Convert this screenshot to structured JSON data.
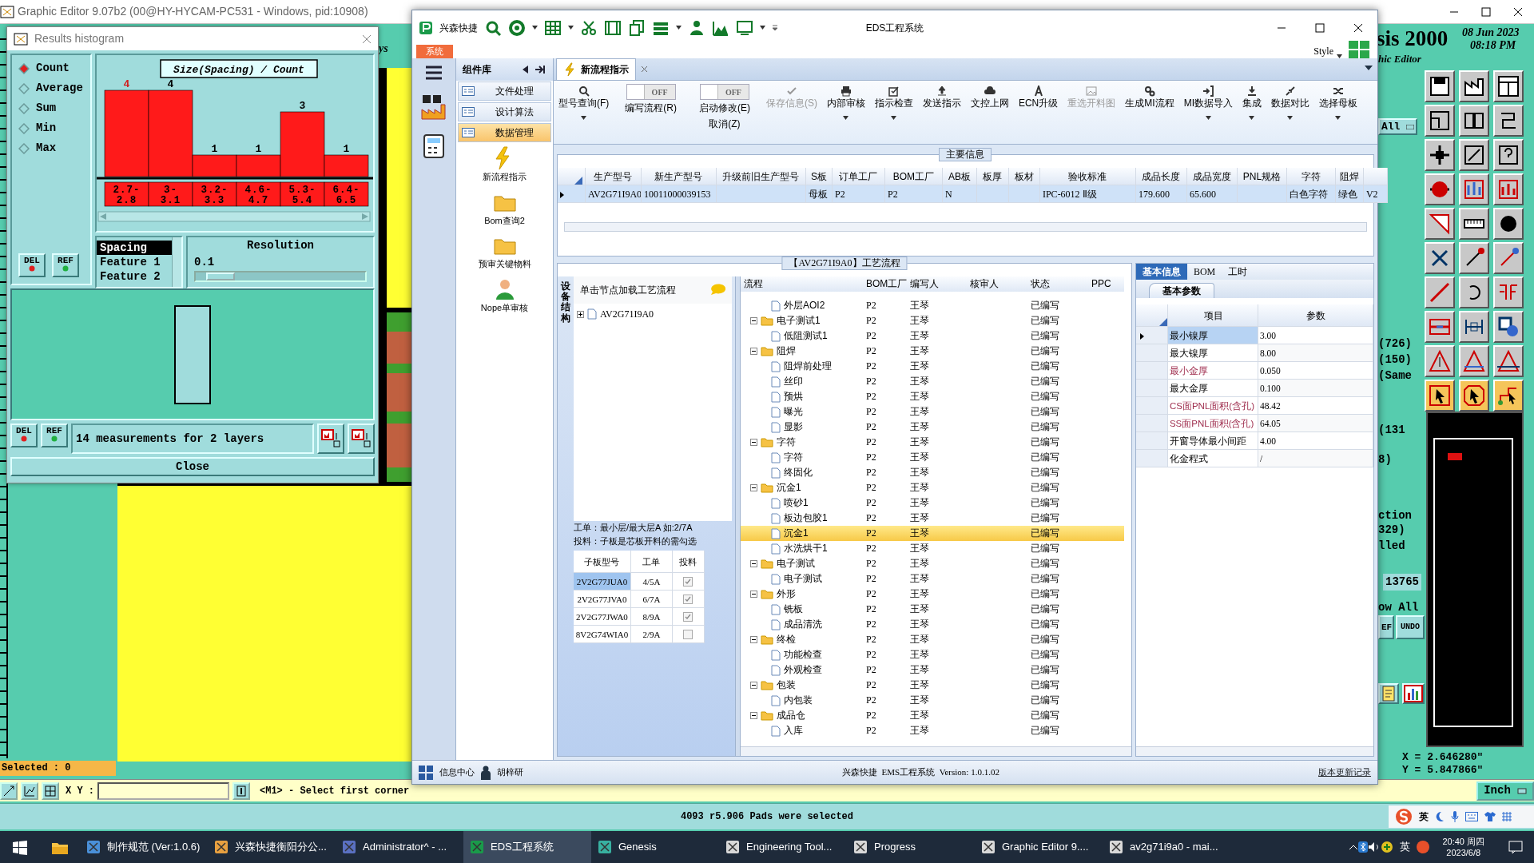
{
  "genesis": {
    "title": "Graphic Editor 9.07b2 (00@HY-HYCAM-PC531 - Windows, pid:10908)",
    "menu_fragment": "ys",
    "product": "sis 2000",
    "date": "08 Jun 2023",
    "time": "08:18 PM",
    "subtitle": "hic Editor",
    "filter": "All",
    "info_lines": [
      "(726)",
      "(150)",
      "(Same",
      "(131",
      "8)",
      "ction",
      "329)",
      "lled"
    ],
    "count": "13765",
    "show_all": "ow All",
    "ref_button": "EF",
    "undo_button": "UNDO",
    "coord_x": "X = 2.646280\"",
    "coord_y": "Y = 5.847866\"",
    "units": "Inch",
    "selected": "Selected : 0",
    "xy_label": "X Y :",
    "prompt": "<M1> - Select first corner",
    "status": "4093 r5.906 Pads were selected"
  },
  "histogram": {
    "title": "Results histogram",
    "modes": [
      {
        "label": "Count",
        "selected": true
      },
      {
        "label": "Average",
        "selected": false
      },
      {
        "label": "Sum",
        "selected": false
      },
      {
        "label": "Min",
        "selected": false
      },
      {
        "label": "Max",
        "selected": false
      }
    ],
    "top_buttons": [
      "DEL",
      "REF"
    ],
    "chart_data": {
      "type": "bar",
      "title": "Size(Spacing) / Count",
      "categories": [
        "2.7-2.8",
        "3-3.1",
        "3.2-3.3",
        "4.6-4.7",
        "5.3-5.4",
        "6.4-6.5"
      ],
      "values": [
        4,
        4,
        1,
        1,
        3,
        1
      ],
      "data_labels": true
    },
    "features": [
      {
        "label": "Spacing",
        "selected": true
      },
      {
        "label": "Feature 1",
        "selected": false
      },
      {
        "label": "Feature 2",
        "selected": false
      }
    ],
    "resolution": {
      "label": "Resolution",
      "value": "0.1",
      "level": 0.06
    },
    "bottom_buttons": [
      "DEL",
      "REF"
    ],
    "summary": "14 measurements for 2 layers",
    "close": "Close"
  },
  "eds": {
    "title": "EDS工程系统",
    "brand": "兴森快捷",
    "app_tab": "系统",
    "style": "Style",
    "nav": {
      "title": "组件库",
      "items": [
        {
          "label": "文件处理",
          "selected": false
        },
        {
          "label": "设计算法",
          "selected": false
        },
        {
          "label": "数据管理",
          "selected": true
        }
      ],
      "tools": [
        "新流程指示",
        "Bom查询2",
        "预审关键物料",
        "Nope单审核"
      ]
    },
    "doc_tab": "新流程指示",
    "ribbon": [
      {
        "kind": "button",
        "label": "型号查询(F)",
        "disabled": false,
        "dropdown": true
      },
      {
        "kind": "toggle",
        "label": "编写流程(R)",
        "state_text": "OFF",
        "on": false
      },
      {
        "kind": "toggle",
        "label": "启动修改(E)",
        "sublabel": "取消(Z)",
        "state_text": "OFF",
        "on": false
      },
      {
        "kind": "button",
        "label": "保存信息(S)",
        "disabled": true,
        "dropdown": false
      },
      {
        "kind": "button",
        "label": "内部审核",
        "disabled": false,
        "dropdown": true
      },
      {
        "kind": "button",
        "label": "指示检查",
        "disabled": false,
        "dropdown": true
      },
      {
        "kind": "button",
        "label": "发送指示",
        "disabled": false,
        "dropdown": false
      },
      {
        "kind": "button",
        "label": "文控上网",
        "disabled": false,
        "dropdown": false
      },
      {
        "kind": "button",
        "label": "ECN升级",
        "disabled": false,
        "dropdown": false
      },
      {
        "kind": "button",
        "label": "重选开料图",
        "disabled": true,
        "dropdown": false
      },
      {
        "kind": "button",
        "label": "生成MI流程",
        "disabled": false,
        "dropdown": false
      },
      {
        "kind": "button",
        "label": "MI数据导入",
        "disabled": false,
        "dropdown": true
      },
      {
        "kind": "button",
        "label": "集成",
        "disabled": false,
        "dropdown": true
      },
      {
        "kind": "button",
        "label": "数据对比",
        "disabled": false,
        "dropdown": true
      },
      {
        "kind": "button",
        "label": "选择母板",
        "disabled": false,
        "dropdown": true
      }
    ],
    "main_info": {
      "title": "主要信息",
      "columns": [
        "生产型号",
        "新生产型号",
        "升级前旧生产型号",
        "S板",
        "订单工厂",
        "BOM工厂",
        "AB板",
        "板厚",
        "板材",
        "验收标准",
        "成品长度",
        "成品宽度",
        "PNL规格",
        "字符",
        "阻焊"
      ],
      "rows": [
        {
          "selected": true,
          "cells": [
            "AV2G71I9A0",
            "10011000039153",
            null,
            "母板",
            "P2",
            "P2",
            "N",
            null,
            null,
            "IPC-6012 Ⅱ级",
            "179.600",
            "65.600",
            null,
            "白色字符",
            "绿色",
            "V2"
          ]
        }
      ]
    },
    "process": {
      "title": "【AV2G71I9A0】工艺流程",
      "side_tab": "设备结构",
      "hint": "单击节点加载工艺流程",
      "root": {
        "label": "AV2G71I9A0",
        "expanded": false
      },
      "notes": [
        "工单：最小层/最大层A 如:2/7A",
        "投料：子板是芯板开料的需勾选"
      ],
      "board_columns": [
        "子板型号",
        "工单",
        "投料"
      ],
      "boards": [
        {
          "model": "2V2G77JUA0",
          "order": "4/5A",
          "checked": true,
          "selected": true
        },
        {
          "model": "2V2G77JVA0",
          "order": "6/7A",
          "checked": true,
          "selected": false
        },
        {
          "model": "2V2G77JWA0",
          "order": "8/9A",
          "checked": true,
          "selected": false
        },
        {
          "model": "8V2G74WIA0",
          "order": "2/9A",
          "checked": false,
          "selected": false
        }
      ],
      "tree_columns": [
        "流程",
        "BOM工厂",
        "编写人",
        "核审人",
        "状态",
        "PPC"
      ],
      "tree": [
        {
          "name": "外层AOI2",
          "factory": "P2",
          "writer": "王琴",
          "status": "已编写",
          "selected": false
        },
        {
          "name": "电子测试1",
          "factory": "P2",
          "writer": "王琴",
          "status": "已编写",
          "selected": false,
          "expanded": true,
          "children": [
            {
              "name": "低阻测试1",
              "factory": "P2",
              "writer": "王琴",
              "status": "已编写",
              "selected": false
            }
          ]
        },
        {
          "name": "阻焊",
          "factory": "P2",
          "writer": "王琴",
          "status": "已编写",
          "selected": false,
          "expanded": true,
          "children": [
            {
              "name": "阻焊前处理",
              "factory": "P2",
              "writer": "王琴",
              "status": "已编写",
              "selected": false
            },
            {
              "name": "丝印",
              "factory": "P2",
              "writer": "王琴",
              "status": "已编写",
              "selected": false
            },
            {
              "name": "预烘",
              "factory": "P2",
              "writer": "王琴",
              "status": "已编写",
              "selected": false
            },
            {
              "name": "曝光",
              "factory": "P2",
              "writer": "王琴",
              "status": "已编写",
              "selected": false
            },
            {
              "name": "显影",
              "factory": "P2",
              "writer": "王琴",
              "status": "已编写",
              "selected": false
            }
          ]
        },
        {
          "name": "字符",
          "factory": "P2",
          "writer": "王琴",
          "status": "已编写",
          "selected": false,
          "expanded": true,
          "children": [
            {
              "name": "字符",
              "factory": "P2",
              "writer": "王琴",
              "status": "已编写",
              "selected": false
            },
            {
              "name": "终固化",
              "factory": "P2",
              "writer": "王琴",
              "status": "已编写",
              "selected": false
            }
          ]
        },
        {
          "name": "沉金1",
          "factory": "P2",
          "writer": "王琴",
          "status": "已编写",
          "selected": false,
          "expanded": true,
          "children": [
            {
              "name": "喷砂1",
              "factory": "P2",
              "writer": "王琴",
              "status": "已编写",
              "selected": false
            },
            {
              "name": "板边包胶1",
              "factory": "P2",
              "writer": "王琴",
              "status": "已编写",
              "selected": false
            },
            {
              "name": "沉金1",
              "factory": "P2",
              "writer": "王琴",
              "status": "已编写",
              "selected": true
            },
            {
              "name": "水洗烘干1",
              "factory": "P2",
              "writer": "王琴",
              "status": "已编写",
              "selected": false
            }
          ]
        },
        {
          "name": "电子测试",
          "factory": "P2",
          "writer": "王琴",
          "status": "已编写",
          "selected": false,
          "expanded": true,
          "children": [
            {
              "name": "电子测试",
              "factory": "P2",
              "writer": "王琴",
              "status": "已编写",
              "selected": false
            }
          ]
        },
        {
          "name": "外形",
          "factory": "P2",
          "writer": "王琴",
          "status": "已编写",
          "selected": false,
          "expanded": true,
          "children": [
            {
              "name": "铣板",
              "factory": "P2",
              "writer": "王琴",
              "status": "已编写",
              "selected": false
            },
            {
              "name": "成品清洗",
              "factory": "P2",
              "writer": "王琴",
              "status": "已编写",
              "selected": false
            }
          ]
        },
        {
          "name": "终检",
          "factory": "P2",
          "writer": "王琴",
          "status": "已编写",
          "selected": false,
          "expanded": true,
          "children": [
            {
              "name": "功能检查",
              "factory": "P2",
              "writer": "王琴",
              "status": "已编写",
              "selected": false
            },
            {
              "name": "外观检查",
              "factory": "P2",
              "writer": "王琴",
              "status": "已编写",
              "selected": false
            }
          ]
        },
        {
          "name": "包装",
          "factory": "P2",
          "writer": "王琴",
          "status": "已编写",
          "selected": false,
          "expanded": true,
          "children": [
            {
              "name": "内包装",
              "factory": "P2",
              "writer": "王琴",
              "status": "已编写",
              "selected": false
            }
          ]
        },
        {
          "name": "成品仓",
          "factory": "P2",
          "writer": "王琴",
          "status": "已编写",
          "selected": false,
          "expanded": true,
          "children": [
            {
              "name": "入库",
              "factory": "P2",
              "writer": "王琴",
              "status": "已编写",
              "selected": false
            }
          ]
        }
      ]
    },
    "info": {
      "tabs": [
        {
          "label": "基本信息",
          "selected": true
        },
        {
          "label": "BOM",
          "selected": false
        },
        {
          "label": "工时",
          "selected": false
        }
      ],
      "subtab": "基本参数",
      "columns": [
        "项目",
        "参数"
      ],
      "rows": [
        {
          "item": "最小镍厚",
          "value": "3.00",
          "highlight": false,
          "selected": true
        },
        {
          "item": "最大镍厚",
          "value": "8.00",
          "highlight": false,
          "selected": false
        },
        {
          "item": "最小金厚",
          "value": "0.050",
          "highlight": true,
          "selected": false
        },
        {
          "item": "最大金厚",
          "value": "0.100",
          "highlight": false,
          "selected": false
        },
        {
          "item": "CS面PNL面积(含孔)",
          "value": "48.42",
          "highlight": true,
          "selected": false
        },
        {
          "item": "SS面PNL面积(含孔)",
          "value": "64.05",
          "highlight": true,
          "selected": false
        },
        {
          "item": "开窗导体最小间距",
          "value": "4.00",
          "highlight": false,
          "selected": false
        },
        {
          "item": "化金程式",
          "value": "/",
          "highlight": false,
          "selected": false
        }
      ]
    },
    "statusbar": {
      "info_center": "信息中心",
      "user": "胡梓研",
      "version": "兴森快捷  EMS工程系统  Version: 1.0.1.02",
      "changelog": "版本更新记录"
    }
  },
  "ime": {
    "lang": "英"
  },
  "taskbar": {
    "items": [
      {
        "label": "制作规范 (Ver:1.0.6)",
        "selected": false
      },
      {
        "label": "兴森快捷衡阳分公...",
        "selected": false
      },
      {
        "label": "Administrator^ - ...",
        "selected": false
      },
      {
        "label": "EDS工程系统",
        "selected": true
      },
      {
        "label": "Genesis",
        "selected": false
      },
      {
        "label": "Engineering Tool...",
        "selected": false
      },
      {
        "label": "Progress",
        "selected": false
      },
      {
        "label": "Graphic Editor 9....",
        "selected": false
      },
      {
        "label": "av2g71i9a0 - mai...",
        "selected": false
      }
    ],
    "lang": "英",
    "time": "20:40 周四",
    "date": "2023/6/8"
  }
}
